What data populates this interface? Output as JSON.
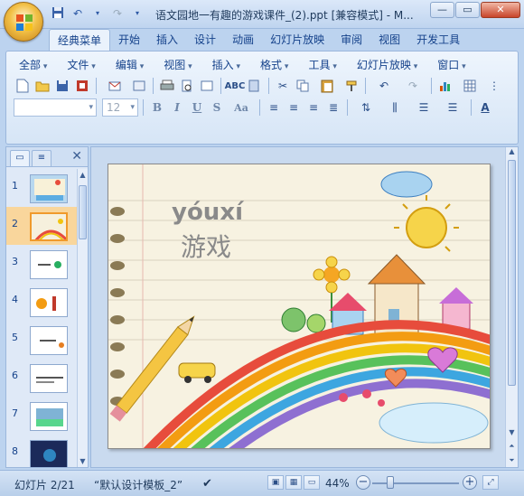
{
  "window": {
    "title": "语文园地一有趣的游戏课件_(2).ppt [兼容模式] - M...",
    "minimize": "—",
    "restore": "▭",
    "close": "✕"
  },
  "qat": [
    "save-icon",
    "undo-icon",
    "redo-icon",
    "customize-qat-icon"
  ],
  "tabs": [
    "经典菜单",
    "开始",
    "插入",
    "设计",
    "动画",
    "幻灯片放映",
    "审阅",
    "视图",
    "开发工具"
  ],
  "active_tab": "经典菜单",
  "menus": [
    "全部",
    "文件",
    "编辑",
    "视图",
    "插入",
    "格式",
    "工具",
    "幻灯片放映",
    "窗口"
  ],
  "font_box": {
    "font": "",
    "size": "12"
  },
  "format_buttons": {
    "bold": "B",
    "italic": "I",
    "underline": "U",
    "strike": "S",
    "case": "Aa"
  },
  "panel": {
    "close": "✕"
  },
  "thumbnails": [
    {
      "num": "1"
    },
    {
      "num": "2",
      "selected": true
    },
    {
      "num": "3"
    },
    {
      "num": "4"
    },
    {
      "num": "5"
    },
    {
      "num": "6"
    },
    {
      "num": "7"
    },
    {
      "num": "8"
    }
  ],
  "slide": {
    "latin": "yóuxí",
    "chinese": "游戏"
  },
  "status": {
    "slide_counter": "幻灯片 2/21",
    "template": "“默认设计模板_2”",
    "zoom": "44%",
    "zoom_minus": "−",
    "zoom_plus": "+"
  },
  "colors": {
    "accent": "#15428b",
    "ribbon": "#dfe9f7",
    "selected_thumb": "#f09a2c"
  }
}
